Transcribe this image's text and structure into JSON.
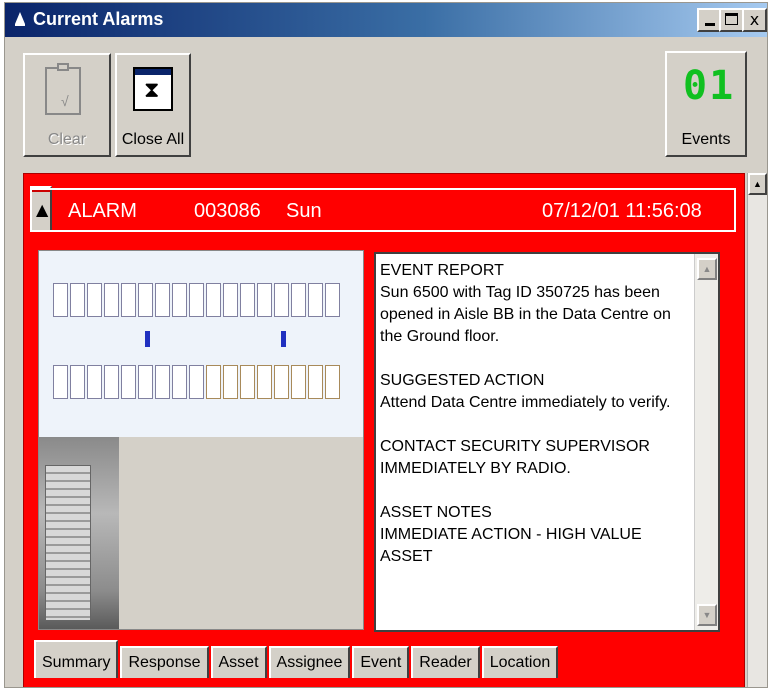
{
  "window": {
    "title": "Current Alarms",
    "controls": {
      "minimize": "",
      "maximize": "",
      "close": "x"
    }
  },
  "toolbar": {
    "clear_label": "Clear",
    "close_all_label": "Close All",
    "events_count": "01",
    "events_label": "Events"
  },
  "alarm": {
    "type": "ALARM",
    "id": "003086",
    "asset": "Sun",
    "timestamp": "07/12/01 11:56:08"
  },
  "report": {
    "text": "EVENT REPORT\nSun 6500 with Tag ID 350725 has been opened in Aisle BB in the Data Centre on the Ground floor.\n\nSUGGESTED ACTION\nAttend Data Centre immediately to verify.\n\nCONTACT SECURITY SUPERVISOR IMMEDIATELY BY RADIO.\n\nASSET NOTES\nIMMEDIATE ACTION - HIGH VALUE ASSET"
  },
  "tabs": [
    "Summary",
    "Response",
    "Asset",
    "Assignee",
    "Event",
    "Reader",
    "Location"
  ],
  "colors": {
    "alarm_bg": "#ff0000",
    "title_bar": "#0a246a",
    "led_green": "#10c020"
  },
  "icons": {
    "title": "alarm-bell-icon",
    "clear": "clipboard-check-icon",
    "close_all": "hourglass-icon",
    "alarm_row": "alarm-bell-icon"
  }
}
